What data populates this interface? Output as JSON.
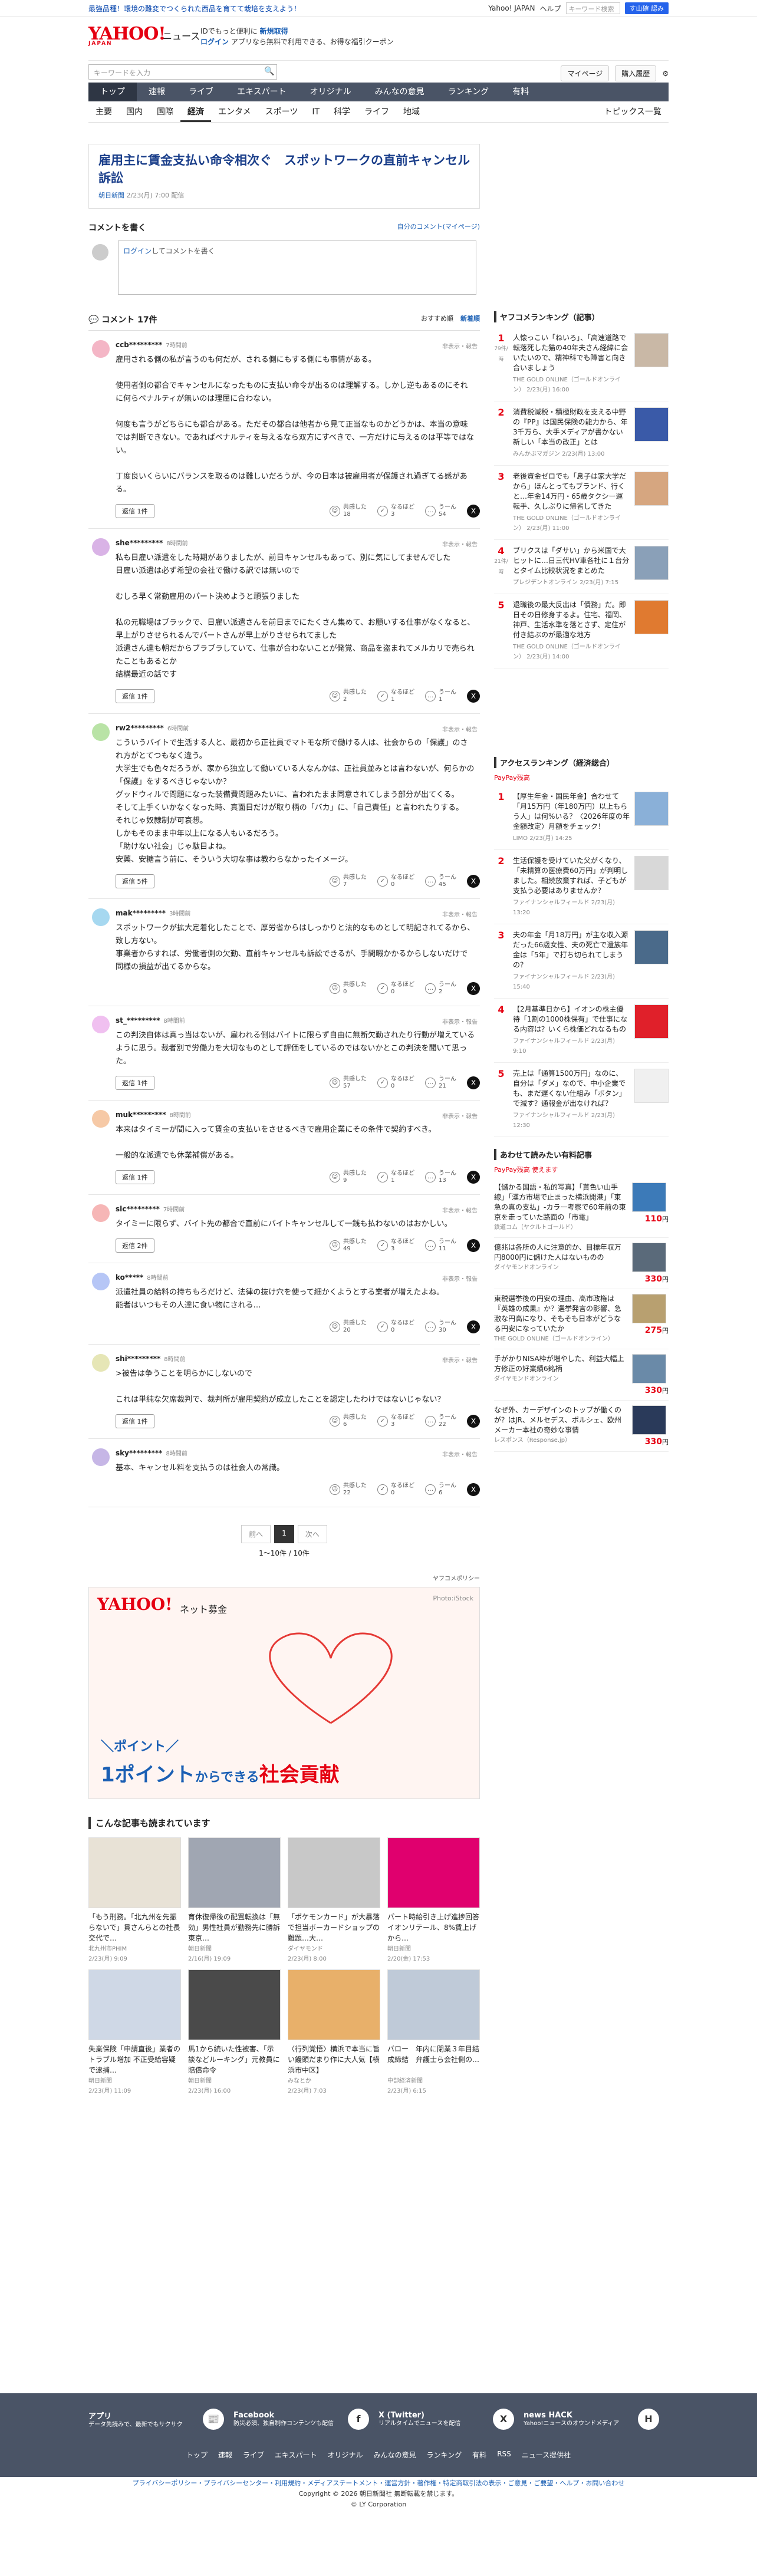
{
  "topline": {
    "promo": "最強品種！環境の難変でつくられた西品を育てて栽培を支えよう！",
    "yahoo_japan": "Yahoo! JAPAN",
    "help": "ヘルプ",
    "search_placeholder": "キーワード検索",
    "search_button": "す山確 認み"
  },
  "header": {
    "logo": "YAHOO!",
    "logo_sub": "JAPAN",
    "section": "ニュース",
    "id_note": "IDでもっと便利に",
    "id_new": "新規取得",
    "login": "ログイン",
    "app_note": "アプリなら無料で利用できる、お得な福引クーポン"
  },
  "searchbar": {
    "placeholder": "キーワードを入力",
    "mypage": "マイページ",
    "purchase": "購入履歴"
  },
  "nav1": [
    "トップ",
    "速報",
    "ライブ",
    "エキスパート",
    "オリジナル",
    "みんなの意見",
    "ランキング",
    "有料"
  ],
  "nav2": [
    "主要",
    "国内",
    "国際",
    "経済",
    "エンタメ",
    "スポーツ",
    "IT",
    "科学",
    "ライフ",
    "地域"
  ],
  "nav2_topics": "トピックス一覧",
  "article": {
    "title": "雇用主に賃金支払い命令相次ぐ　スポットワークの直前キャンセル訴訟",
    "source": "朝日新聞",
    "date": "2/23(月) 7:00 配信"
  },
  "comment_write": {
    "title": "コメントを書く",
    "mine": "自分のコメント(マイページ)",
    "login_text": "ログイン",
    "login_tail": "してコメントを書く"
  },
  "comments_bar": {
    "count": "コメント 17件",
    "sort_recommend": "おすすめ順",
    "sort_new": "新着順"
  },
  "comments": [
    {
      "user": "ccb*********",
      "time": "7時間前",
      "report": "非表示・報告",
      "body": "雇用される側の私が言うのも何だが、される側にもする側にも事情がある。\n\n使用者側の都合でキャンセルになったものに支払い命令が出るのは理解する。しかし逆もあるのにそれに何らペナルティが無いのは理屈に合わない。\n\n何度も言うがどちらにも都合がある。ただその都合は他者から見て正当なものかどうかは、本当の意味では判断できない。であればペナルティを与えるなら双方にすべきで、一方だけに与えるのは平等ではない。\n\n丁度良いくらいにバランスを取るのは難しいだろうが、今の日本は被雇用者が保護され過ぎてる感がある。",
      "reply": "返信 1件",
      "v1_label": "共感した",
      "v1": "18",
      "v2_label": "なるほど",
      "v2": "3",
      "v3_label": "うーん",
      "v3": "54",
      "color": "#f4b6c6"
    },
    {
      "user": "she*********",
      "time": "8時間前",
      "report": "非表示・報告",
      "body": "私も日雇い派遣をした時期がありましたが、前日キャンセルもあって、別に気にしてませんでした\n日雇い派遣は必ず希望の会社で働ける訳では無いので\n\nむしろ早く常勤雇用のパート決めようと頑張りました\n\n私の元職場はブラックで、日雇い派遣さんを前日までにたくさん集めて、お願いする仕事がなくなると、早上がりさせられるんでパートさんが早上がりさせられてました\n派遣さん達も朝だからブラブラしていて、仕事が合わないことが発覚、商品を盗まれてメルカリで売られたこともあるとか\n結構最近の話です",
      "reply": "返信 1件",
      "v1_label": "共感した",
      "v1": "2",
      "v2_label": "なるほど",
      "v2": "1",
      "v3_label": "うーん",
      "v3": "1",
      "color": "#d9b3e6"
    },
    {
      "user": "rw2*********",
      "time": "6時間前",
      "report": "非表示・報告",
      "body": "こういうバイトで生活する人と、最初から正社員でマトモな所で働ける人は、社会からの「保護」のされ方がとてつもなく違う。\n大学生でも色々だろうが、家から独立して働いている人なんかは、正社員並みとは言わないが、何らかの「保護」をするべきじゃないか？\nグッドウィルで問題になった装備費問題みたいに、言われたまま同意されてしまう部分が出てくる。\nそして上手くいかなくなった時、真面目だけが取り柄の「バカ」に、「自己責任」と言われたりする。\nそれじゃ奴隷制が可哀想。\nしかもそのまま中年以上になる人もいるだろう。\n「助けない社会」じゃ駄目よね。\n安藥、安糖言う前に、そういう大切な事は教わらなかったイメージ。",
      "reply": "返信 5件",
      "v1_label": "共感した",
      "v1": "7",
      "v2_label": "なるほど",
      "v2": "0",
      "v3_label": "うーん",
      "v3": "45",
      "color": "#b9e3a6"
    },
    {
      "user": "mak*********",
      "time": "3時間前",
      "report": "非表示・報告",
      "body": "スポットワークが拡大定着化したことで、厚労省からはしっかりと法的なものとして明記されてるから、致し方ない。\n事業者からすれば、労働者側の欠勤、直前キャンセルも訴訟できるが、手間暇かかるからしないだけで同様の損益が出てるからな。",
      "reply": "",
      "v1_label": "共感した",
      "v1": "0",
      "v2_label": "なるほど",
      "v2": "0",
      "v3_label": "うーん",
      "v3": "2",
      "color": "#a6d8f0"
    },
    {
      "user": "st_*********",
      "time": "8時間前",
      "report": "非表示・報告",
      "body": "この判決自体は真っ当はないが、雇われる側はバイトに限らず自由に無断欠勤されたり行動が増えているように思う。裁者別で労働力を大切なものとして評価をしているのではないかとこの判決を聞いて思った。",
      "reply": "返信 1件",
      "v1_label": "共感した",
      "v1": "57",
      "v2_label": "なるほど",
      "v2": "0",
      "v3_label": "うーん",
      "v3": "21",
      "color": "#f0c0f0"
    },
    {
      "user": "muk*********",
      "time": "8時間前",
      "report": "非表示・報告",
      "body": "本来はタイミーが間に入って賃金の支払いをさせるべきで雇用企業にその条件で契約すべき。\n\n一般的な派遣でも休業補償がある。",
      "reply": "返信 1件",
      "v1_label": "共感した",
      "v1": "9",
      "v2_label": "なるほど",
      "v2": "1",
      "v3_label": "うーん",
      "v3": "13",
      "color": "#f6c9a6"
    },
    {
      "user": "slc*********",
      "time": "7時間前",
      "report": "非表示・報告",
      "body": "タイミーに限らず、バイト先の都合で直前にバイトキャンセルして一銭も払わないのはおかしい。",
      "reply": "返信 2件",
      "v1_label": "共感した",
      "v1": "49",
      "v2_label": "なるほど",
      "v2": "3",
      "v3_label": "うーん",
      "v3": "11",
      "color": "#f6b6b6"
    },
    {
      "user": "ko*****",
      "time": "8時間前",
      "report": "非表示・報告",
      "body": "派遣社員の給料の持ちもろだけど、法律の抜け穴を使って細かくようとする業者が増えたよね。\n能者はいつもその人達に食い物にされる…",
      "reply": "",
      "v1_label": "共感した",
      "v1": "20",
      "v2_label": "なるほど",
      "v2": "0",
      "v3_label": "うーん",
      "v3": "30",
      "color": "#b6c6f6"
    },
    {
      "user": "shi*********",
      "time": "8時間前",
      "report": "非表示・報告",
      "body": ">被告は争うことを明らかにしないので\n\nこれは単純な欠席裁判で、裁判所が雇用契約が成立したことを認定したわけではないじゃない？",
      "reply": "返信 1件",
      "v1_label": "共感した",
      "v1": "6",
      "v2_label": "なるほど",
      "v2": "3",
      "v3_label": "うーん",
      "v3": "22",
      "color": "#e6e6b6"
    },
    {
      "user": "sky*********",
      "time": "8時間前",
      "report": "非表示・報告",
      "body": "基本、キャンセル料を支払うのは社会人の常識。",
      "reply": "",
      "v1_label": "共感した",
      "v1": "22",
      "v2_label": "なるほど",
      "v2": "0",
      "v3_label": "うーん",
      "v3": "6",
      "color": "#c6b6e6"
    }
  ],
  "pager": {
    "prev": "前へ",
    "current": "1",
    "next": "次へ",
    "count": "1〜10件 / 10件"
  },
  "policy": "ヤフコメポリシー",
  "banner": {
    "logo": "YAHOO!",
    "logo_sub": "JAPAN",
    "kikin": "ネット募金",
    "photo": "Photo:iStock",
    "tag": "＼ポイント／",
    "main_a": "1ポイント",
    "main_b": "からできる",
    "main_c": "社会貢献"
  },
  "also": {
    "title": "こんな記事も読まれています",
    "items": [
      {
        "title": "「もう刑務。「北九州を先振らないで」貫さんらとの社長交代で…",
        "src": "北九州市PHIM",
        "date": "2/23(月) 9:09"
      },
      {
        "title": "育休復帰後の配置転換は「無効」男性社員が勤務先に勝訴　東京…",
        "src": "朝日新聞",
        "date": "2/16(月) 19:09"
      },
      {
        "title": "「ポケモンカード」が大暴落で担当ボーカードショップの難題…大…",
        "src": "ダイヤモンド",
        "date": "2/23(月) 8:00"
      },
      {
        "title": "パート時給引き上げ進捗回答　イオンリテール、8%賃上げから…",
        "src": "朝日新聞",
        "date": "2/20(金) 17:53"
      },
      {
        "title": "失業保険「申請直後」業者のトラブル増加 不正受給容疑で逮捕…",
        "src": "朝日新聞",
        "date": "2/23(月) 11:09"
      },
      {
        "title": "馬1から続いた性被害、「示談などルーキング」元教員に賠償命令",
        "src": "朝日新聞",
        "date": "2/23(月) 16:00"
      },
      {
        "title": "〈行列覚悟〉横浜で本当に旨い饅頭だまり作に大人気【横浜市中区】",
        "src": "みなとか",
        "date": "2/23(月) 7:03"
      },
      {
        "title": "バロー　年内に閉業３年目結成締結　弁護士ら会社側の…",
        "src": "中部経済新聞",
        "date": "2/23(月) 6:15"
      }
    ]
  },
  "ranking": {
    "title": "ヤフコメランキング（記事）",
    "items": [
      {
        "num": "1",
        "count": "79",
        "count_label": "件/時",
        "title": "人懐っこい「ねいろ」、「高速道路で転落死した猫の40年夫さん経緯に会いたいので、精神科でも障害と向き合いましょう",
        "src": "THE GOLD ONLINE（ゴールドオンライン）",
        "date": "2/23(月) 16:00"
      },
      {
        "num": "2",
        "count": "",
        "count_label": "",
        "title": "消費税減税・積極財政を支える中野の『PP』は国民保険の能力から、年3千万ら、大手メディアが書かない新しい「本当の改正」とは",
        "src": "みんかぶマガジン",
        "date": "2/23(月) 13:00"
      },
      {
        "num": "3",
        "count": "",
        "count_label": "",
        "title": "老後資金ゼロでも「息子は家大学だから」ほんとってもブランド、行くと…年金14万円・65歳タクシー運転手、久しぶりに帰省してきた",
        "src": "THE GOLD ONLINE（ゴールドオンライン）",
        "date": "2/23(月) 11:00"
      },
      {
        "num": "4",
        "count": "21",
        "count_label": "件/時",
        "title": "ブリクスは「ダサい」から米国で大ヒットに…日三代HV車各社に１台分とタイム比較状況をまとめた",
        "src": "プレジデントオンライン",
        "date": "2/23(月) 7:15"
      },
      {
        "num": "5",
        "count": "",
        "count_label": "",
        "title": "退職後の最大反出は「債務」だ。即日その日修身するよ。住宅、福岡、神戸、生活水準を落とさず、定住が付き結ぶのが最適な地方",
        "src": "THE GOLD ONLINE（ゴールドオンライン）",
        "date": "2/23(月) 14:00"
      }
    ]
  },
  "access_ranking": {
    "title": "アクセスランキング（経済総合）",
    "paypay": "PayPay残高",
    "items": [
      {
        "num": "1",
        "title": "【厚生年金・国民年金】合わせて「月15万円（年180万円）以上もらう人」は何%いる？〈2026年度の年金額改定〉月額をチェック！",
        "src": "LIMO",
        "date": "2/23(月) 14:25"
      },
      {
        "num": "2",
        "title": "生活保護を受けていた父がくなり、「未精算の医療費60万円」が判明しました。相続放棄すれば、子どもが支払う必要はありませんか？",
        "src": "ファイナンシャルフィールド",
        "date": "2/23(月) 13:20"
      },
      {
        "num": "3",
        "title": "夫の年金「月18万円」が主な収入源だった66歳女性、夫の死亡で遺族年金は「5年」で打ち切られてしまうの？",
        "src": "ファイナンシャルフィールド",
        "date": "2/23(月) 15:40"
      },
      {
        "num": "4",
        "title": "【2月基準日から】イオンの株主優待「1割の1000株保有」で仕事になる内容は？いくら株価どれなるもの",
        "src": "ファイナンシャルフィールド",
        "date": "2/23(月) 9:10"
      },
      {
        "num": "5",
        "title": "売上は「通算1500万円」なのに、自分は「ダメ」なので、中小企業でも、まだ遅くない仕組み「ボタン」で減す？通報金が出なければ？",
        "src": "ファイナンシャルフィールド",
        "date": "2/23(月) 12:30"
      }
    ]
  },
  "paid": {
    "title": "あわせて読みたい有料記事",
    "paypay": "PayPay残高 使えます",
    "items": [
      {
        "title": "【儲かる国語・私的写真】「貰色い山手線」「漢方市場で止まった横浜開港」「東急の真の支払」-カラー考察で60年前の東京を走っていた路面の「市電」",
        "src": "鉄道コム（ヤクルトゴールド）",
        "price": "110",
        "unit": "円"
      },
      {
        "title": "億兆は各所の人に注意的か、目標年収万円8000円に儲けた人はないものの",
        "src": "ダイヤモンドオンライン",
        "price": "330",
        "unit": "円"
      },
      {
        "title": "東税選挙後の円安の理由、高市政権は『英雄の成果』か？選挙発言の影響、急激な円高になり、そもそも日本がどうなる円安になっていたか",
        "src": "THE GOLD ONLINE（ゴールドオンライン）",
        "price": "275",
        "unit": "円"
      },
      {
        "title": "手がかりNISA枠が増やした、利益大幅上方修正の好業績6銘柄",
        "src": "ダイヤモンドオンライン",
        "price": "330",
        "unit": "円"
      },
      {
        "title": "なぜ外、カーデザインのトップが働くのが？はJR、メルセデス、ポルシェ、欧州メーカー本社の奇妙な事情",
        "src": "レスポンス（Response.jp）",
        "price": "330",
        "unit": "円"
      }
    ]
  },
  "footer": {
    "apps": [
      {
        "t": "アプリ",
        "d": "データ先読みで、最新でもサクサク",
        "ic": "📰"
      },
      {
        "t": "Facebook",
        "d": "防災必須、独自制作コンテンツも配信",
        "ic": "f"
      },
      {
        "t": "X (Twitter)",
        "d": "リアルタイムでニュースを配信",
        "ic": "X"
      },
      {
        "t": "news HACK",
        "d": "Yahoo!ニュースのオウンドメディア",
        "ic": "H"
      }
    ],
    "nav": [
      "トップ",
      "速報",
      "ライブ",
      "エキスパート",
      "オリジナル",
      "みんなの意見",
      "ランキング",
      "有料",
      "RSS",
      "ニュース提供社"
    ],
    "links": "プライバシーポリシー・プライバシーセンター・利用規約・メディアステートメント・運営方針・著作権・特定商取引法の表示・ご意見・ご要望・ヘルプ・お問い合わせ",
    "copyright1": "Copyright © 2026 朝日新聞社 無断転載を禁じます。",
    "copyright2": "© LY Corporation"
  }
}
